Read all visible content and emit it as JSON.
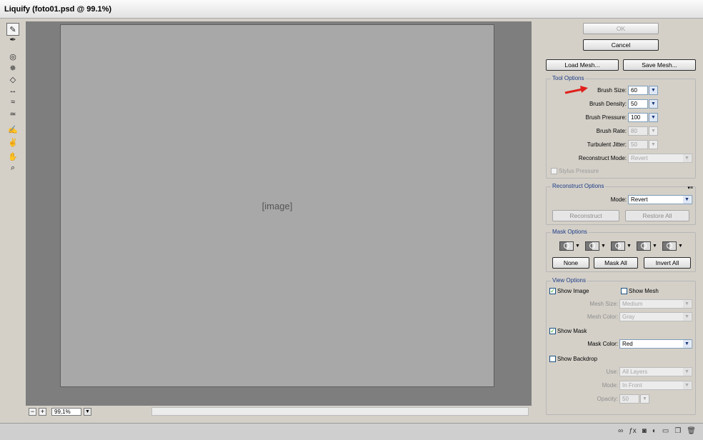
{
  "window": {
    "title": "Liquify (foto01.psd @ 99.1%)"
  },
  "canvas": {
    "placeholder": "[image]"
  },
  "zoom": {
    "value": "99,1%",
    "minus": "−",
    "plus": "+"
  },
  "tools": [
    {
      "name": "forward-warp-icon",
      "glyph": "✎"
    },
    {
      "name": "reconstruct-icon",
      "glyph": "✒"
    },
    {
      "name": "twirl-icon",
      "glyph": "◎"
    },
    {
      "name": "pucker-icon",
      "glyph": "✵"
    },
    {
      "name": "bloat-icon",
      "glyph": "◇"
    },
    {
      "name": "push-left-icon",
      "glyph": "↔"
    },
    {
      "name": "mirror-icon",
      "glyph": "≈"
    },
    {
      "name": "turbulence-icon",
      "glyph": "≃"
    },
    {
      "name": "freeze-mask-icon",
      "glyph": "✍"
    },
    {
      "name": "thaw-mask-icon",
      "glyph": "✌"
    },
    {
      "name": "hand-icon",
      "glyph": "✋"
    },
    {
      "name": "zoom-icon",
      "glyph": "⌕"
    }
  ],
  "buttons": {
    "ok": "OK",
    "cancel": "Cancel",
    "load_mesh": "Load Mesh...",
    "save_mesh": "Save Mesh..."
  },
  "tool_options": {
    "title": "Tool Options",
    "brush_size": {
      "label": "Brush Size:",
      "value": "60"
    },
    "brush_density": {
      "label": "Brush Density:",
      "value": "50"
    },
    "brush_pressure": {
      "label": "Brush Pressure:",
      "value": "100"
    },
    "brush_rate": {
      "label": "Brush Rate:",
      "value": "80"
    },
    "turbulent_jitter": {
      "label": "Turbulent Jitter:",
      "value": "50"
    },
    "reconstruct_mode": {
      "label": "Reconstruct Mode:",
      "value": "Revert"
    },
    "stylus_pressure": {
      "label": "Stylus Pressure",
      "checked": false
    }
  },
  "reconstruct_options": {
    "title": "Reconstruct Options",
    "mode": {
      "label": "Mode:",
      "value": "Revert"
    },
    "reconstruct": "Reconstruct",
    "restore_all": "Restore All"
  },
  "mask_options": {
    "title": "Mask Options",
    "modes": [
      "replace-selection-icon",
      "add-to-selection-icon",
      "subtract-from-selection-icon",
      "intersect-with-selection-icon",
      "invert-selection-icon"
    ],
    "none": "None",
    "mask_all": "Mask All",
    "invert_all": "Invert All"
  },
  "view_options": {
    "title": "View Options",
    "show_image": {
      "label": "Show Image",
      "checked": true
    },
    "show_mesh": {
      "label": "Show Mesh",
      "checked": false
    },
    "mesh_size": {
      "label": "Mesh Size:",
      "value": "Medium"
    },
    "mesh_color": {
      "label": "Mesh Color:",
      "value": "Gray"
    },
    "show_mask": {
      "label": "Show Mask",
      "checked": true
    },
    "mask_color": {
      "label": "Mask Color:",
      "value": "Red"
    },
    "show_backdrop": {
      "label": "Show Backdrop",
      "checked": false
    },
    "use": {
      "label": "Use:",
      "value": "All Layers"
    },
    "mode": {
      "label": "Mode:",
      "value": "In Front"
    },
    "opacity": {
      "label": "Opacity:",
      "value": "50"
    }
  },
  "annotation_color": "#e0201b",
  "check_glyph": "✓",
  "dropdown_glyph": "▼"
}
